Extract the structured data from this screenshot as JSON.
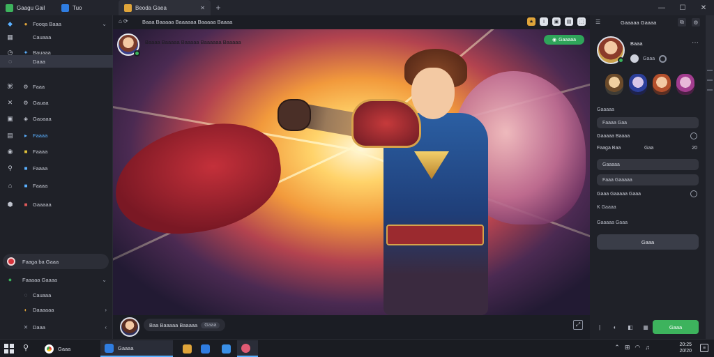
{
  "titlebar": {
    "tabs": [
      {
        "label": "Gaagu Gail",
        "icon": "game-icon"
      },
      {
        "label": "Tuo",
        "icon": "app-icon"
      },
      {
        "label": "Beoda Gaea",
        "icon": "app-icon"
      }
    ],
    "new_tab_label": "+",
    "window_controls": [
      "—",
      "☐",
      "✕"
    ]
  },
  "sidebar": {
    "items": [
      {
        "icon": "dropbox-icon",
        "sub": "●",
        "label": "Fooqa Baaa",
        "chevron": "⌄"
      },
      {
        "icon": "grid-icon",
        "sub": "",
        "label": "Cauaaa"
      },
      {
        "icon": "clock-icon",
        "sub": "",
        "label": "Bauaaa"
      },
      {
        "icon": "circle-icon",
        "sub": "",
        "label": "Daaa",
        "active": true
      },
      {
        "icon": "controller-icon",
        "sub": "",
        "label": "Faaa"
      },
      {
        "icon": "tools-icon",
        "sub": "",
        "label": "Gauaa"
      },
      {
        "icon": "cube-icon",
        "sub": "",
        "label": "Gaoaaa"
      },
      {
        "icon": "store-icon",
        "sub": "",
        "label": "Faaaa",
        "blue": true
      },
      {
        "icon": "shield-icon",
        "sub": "",
        "label": "Faaaa"
      },
      {
        "icon": "wrench-icon",
        "sub": "",
        "label": "Faaaa"
      },
      {
        "icon": "gift-icon",
        "sub": "",
        "label": "Faaaa"
      },
      {
        "icon": "lock-icon",
        "sub": "",
        "label": "Gaaaaa"
      }
    ],
    "record_label": "Faaga ba Gaaa",
    "lower_items": [
      {
        "icon": "circle-icon",
        "label": "Faaaaa Gaaaa",
        "chevron": "⌄"
      },
      {
        "icon": "",
        "label": "Cauaaa"
      },
      {
        "icon": "",
        "label": "Daaaaaa",
        "chevron": "›"
      },
      {
        "icon": "",
        "label": "Daaa",
        "chevron": "‹"
      }
    ]
  },
  "content": {
    "toolbar_label": "Baaa Baaaaa Baaaaaa Baaaaa Baaaa",
    "stage_title": "Baaaa Baaaaa Baaaaa Baaaaaa Baaaaa",
    "live_label": "Gaaaaa",
    "presenter_name": "Baa Baaaaa Baaaaa",
    "presenter_tag": "Gaaa"
  },
  "right_panel": {
    "title": "Gaaaaa Gaaaa",
    "profile_name": "Baaa",
    "profile_sub": "Gaaa",
    "section_label": "Gaaaaa",
    "field_1": "Faaaa Gaa",
    "row_1": "Gaaaaa Baaaa",
    "row_2_label": "Faaga Baa",
    "row_2_mid": "Gaa",
    "row_2_value": "20",
    "field_2": "Gaaaaa",
    "field_3": "Faaa Gaaaaa",
    "row_3": "Gaaa Gaaaaa Gaaa",
    "row_4": "K Gaaaa",
    "row_5": "Gaaaaa Gaaa",
    "button_label": "Gaaa",
    "join_label": "Gaaa"
  },
  "taskbar": {
    "apps": [
      {
        "label": "Gaaa",
        "icon": "chrome-icon"
      },
      {
        "label": "Gaaaa",
        "icon": "app-icon"
      }
    ],
    "clock_time": "20:25",
    "clock_date": "20/20"
  }
}
